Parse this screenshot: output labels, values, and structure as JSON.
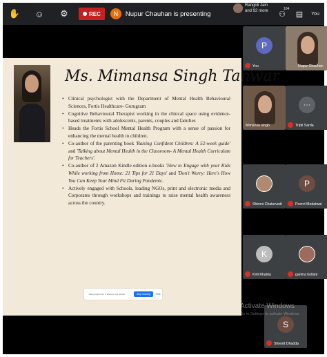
{
  "topbar": {
    "rec_label": "REC",
    "presenter_initial": "N",
    "presenting_text": "Nupur Chauhan is presenting",
    "people_text_line1": "Rangoli Jain",
    "people_text_line2": "and 92 more",
    "participant_count": "104",
    "you_label": "You"
  },
  "slide": {
    "title": "Ms. Mimansa Singh Tanwar",
    "bullets": [
      {
        "plain": "Clinical psychologist with the Department of Mental Health Behavioural Sciences, Fortis Healthcare- Gurugram"
      },
      {
        "plain": "Cognitive Behavioural Therapist working in the clinical space using evidence-based treatments with adolescents, parents, couples and families"
      },
      {
        "plain": "Heads the Fortis School Mental Health Program with a sense of passion for enhancing the mental health in children."
      },
      {
        "pre": "Co-author of the parenting book ",
        "em1": "'Raising Confident Children: A 52-week guide'",
        "mid": " and ",
        "em2": "'Talking about Mental Health in the Classroom- A Mental Health Curriculum for Teachers'",
        "post": "."
      },
      {
        "pre": "Co-author of 2 Amazon Kindle edition e-books ",
        "em1": "'How to Engage with your Kids While working from Home: 21 Tips for 21 Days'",
        "mid": " and ",
        "em2": "'Don't Worry: Here's How You Can Keep Your Mind Fit During Pandemic.",
        "post": ""
      },
      {
        "plain": "Actively engaged with Schools, leading NGOs, print and electronic media and Corporates through workshops and trainings to raise mental health awareness across the country."
      }
    ],
    "share_bar": {
      "text": "meet.google.com is sharing your screen",
      "stop_label": "Stop sharing",
      "hide_label": "Hide"
    }
  },
  "tiles": [
    {
      "name": "You",
      "initial": "P",
      "color": "#5c6bc0"
    },
    {
      "name": "Nupur Chauhan"
    },
    {
      "name": "Mimansa singh"
    },
    {
      "name": "Tripti Sarda",
      "initial": "",
      "color": "#3c4043"
    },
    {
      "name": "Shironi Chaturvedi"
    },
    {
      "name": "Poorvi Medatwal",
      "initial": "P",
      "color": "#6d4c41"
    },
    {
      "name": "Kirti Khatria",
      "initial": "K",
      "color": "#bdbdbd"
    },
    {
      "name": "garima hollani"
    },
    {
      "name": "Shrestt Dhadda",
      "initial": "S",
      "color": "#6d4c41"
    }
  ],
  "watermark": {
    "title": "Activate Windows",
    "subtitle": "Go to Settings to activate Windows."
  }
}
